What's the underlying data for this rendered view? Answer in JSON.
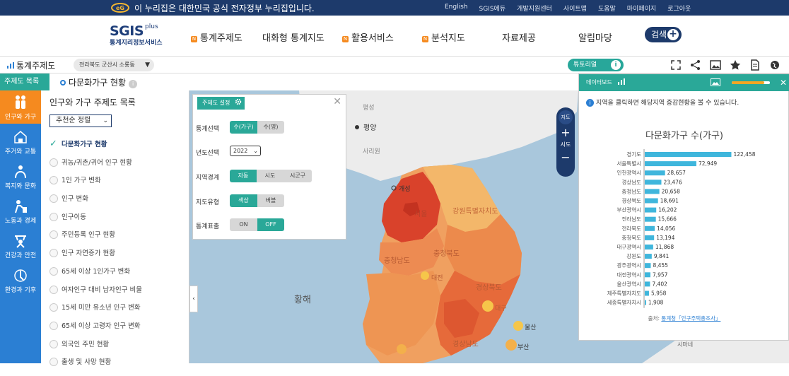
{
  "gov_bar": {
    "notice": "이 누리집은 대한민국 공식 전자정부 누리집입니다.",
    "links": [
      "English",
      "SGIS에듀",
      "개발지원센터",
      "사이트맵",
      "도움말",
      "마이페이지",
      "로그아웃"
    ]
  },
  "header": {
    "logo_main": "SGIS",
    "logo_plus": "plus",
    "logo_sub": "통계지리정보서비스",
    "nav": [
      {
        "label": "통계주제도",
        "badge": "N"
      },
      {
        "label": "대화형 통계지도",
        "badge": ""
      },
      {
        "label": "활용서비스",
        "badge": "N"
      },
      {
        "label": "분석지도",
        "badge": "N"
      },
      {
        "label": "자료제공",
        "badge": ""
      },
      {
        "label": "알림마당",
        "badge": ""
      }
    ],
    "search_label": "검색"
  },
  "toolbar": {
    "title": "통계주제도",
    "region": "전라북도 군산시 소룡동",
    "tutorial": "튜토리얼"
  },
  "subbar": {
    "theme_list_label": "주제도 목록",
    "theme_title": "다문화가구 현황"
  },
  "categories": [
    "인구와 가구",
    "주거와 교통",
    "복지와 문화",
    "노동과 경제",
    "건강과 안전",
    "환경과 기후"
  ],
  "panel": {
    "title": "인구와 가구 주제도 목록",
    "sort": "추천순 정렬",
    "items": [
      "다문화가구 현황",
      "귀농/귀촌/귀어 인구 현황",
      "1인 가구 변화",
      "인구 변화",
      "인구이동",
      "주민등록 인구 현황",
      "인구 자연증가 현황",
      "65세 이상 1인가구 변화",
      "여자인구 대비 남자인구 비율",
      "15세 미만 유소년 인구 변화",
      "65세 이상 고령자 인구 변화",
      "외국인 주민 현황",
      "출생 및 사망 현황"
    ]
  },
  "settings": {
    "title": "주제도 설정",
    "stat_label": "통계선택",
    "stat_options": [
      "수(가구)",
      "수(명)"
    ],
    "year_label": "년도선택",
    "year": "2022",
    "boundary_label": "지역경계",
    "boundary_options": [
      "자동",
      "시도",
      "시군구"
    ],
    "maptype_label": "지도유형",
    "maptype_options": [
      "색상",
      "버블"
    ],
    "statlabel_label": "통계표출",
    "statlabel_options": [
      "ON",
      "OFF"
    ]
  },
  "map": {
    "labels": [
      "평양",
      "개성",
      "황해",
      "울산",
      "부산",
      "대전",
      "대구",
      "서울",
      "강원특별자치도",
      "경상북도",
      "경상남도",
      "충청북도",
      "충청남도",
      "사리원",
      "평성",
      "시마네"
    ],
    "zoom_map": "지도",
    "zoom_plus": "+",
    "zoom_level": "시도",
    "zoom_minus": "−"
  },
  "dashboard": {
    "title": "데이터보드",
    "note": "지역을 클릭하면 해당지역 증감현황을 볼 수 있습니다.",
    "chart_title": "다문화가구 수(가구)",
    "source_label": "출처:",
    "source_link": "통계청「인구주택총조사」"
  },
  "chart_data": {
    "type": "bar",
    "title": "다문화가구 수(가구)",
    "categories": [
      "경기도",
      "서울특별시",
      "인천광역시",
      "경상남도",
      "충청남도",
      "경상북도",
      "부산광역시",
      "전라남도",
      "전라북도",
      "충청북도",
      "대구광역시",
      "강원도",
      "광주광역시",
      "대전광역시",
      "울산광역시",
      "제주특별자치도",
      "세종특별자치시"
    ],
    "values": [
      122458,
      72949,
      28657,
      23476,
      20658,
      18691,
      16202,
      15666,
      14056,
      13194,
      11868,
      9841,
      8455,
      7957,
      7402,
      5958,
      1908
    ],
    "value_labels": [
      "122,458",
      "72,949",
      "28,657",
      "23,476",
      "20,658",
      "18,691",
      "16,202",
      "15,666",
      "14,056",
      "13,194",
      "11,868",
      "9,841",
      "8,455",
      "7,957",
      "7,402",
      "5,958",
      "1,908"
    ],
    "xlim": [
      0,
      130000
    ],
    "bar_color": "#3fb6dc",
    "grid": false
  },
  "colors": {
    "navy": "#1d3a6b",
    "teal": "#2aa898",
    "blue": "#2b7fd3",
    "orange": "#f58a1f",
    "sea": "#a9c7dc"
  }
}
